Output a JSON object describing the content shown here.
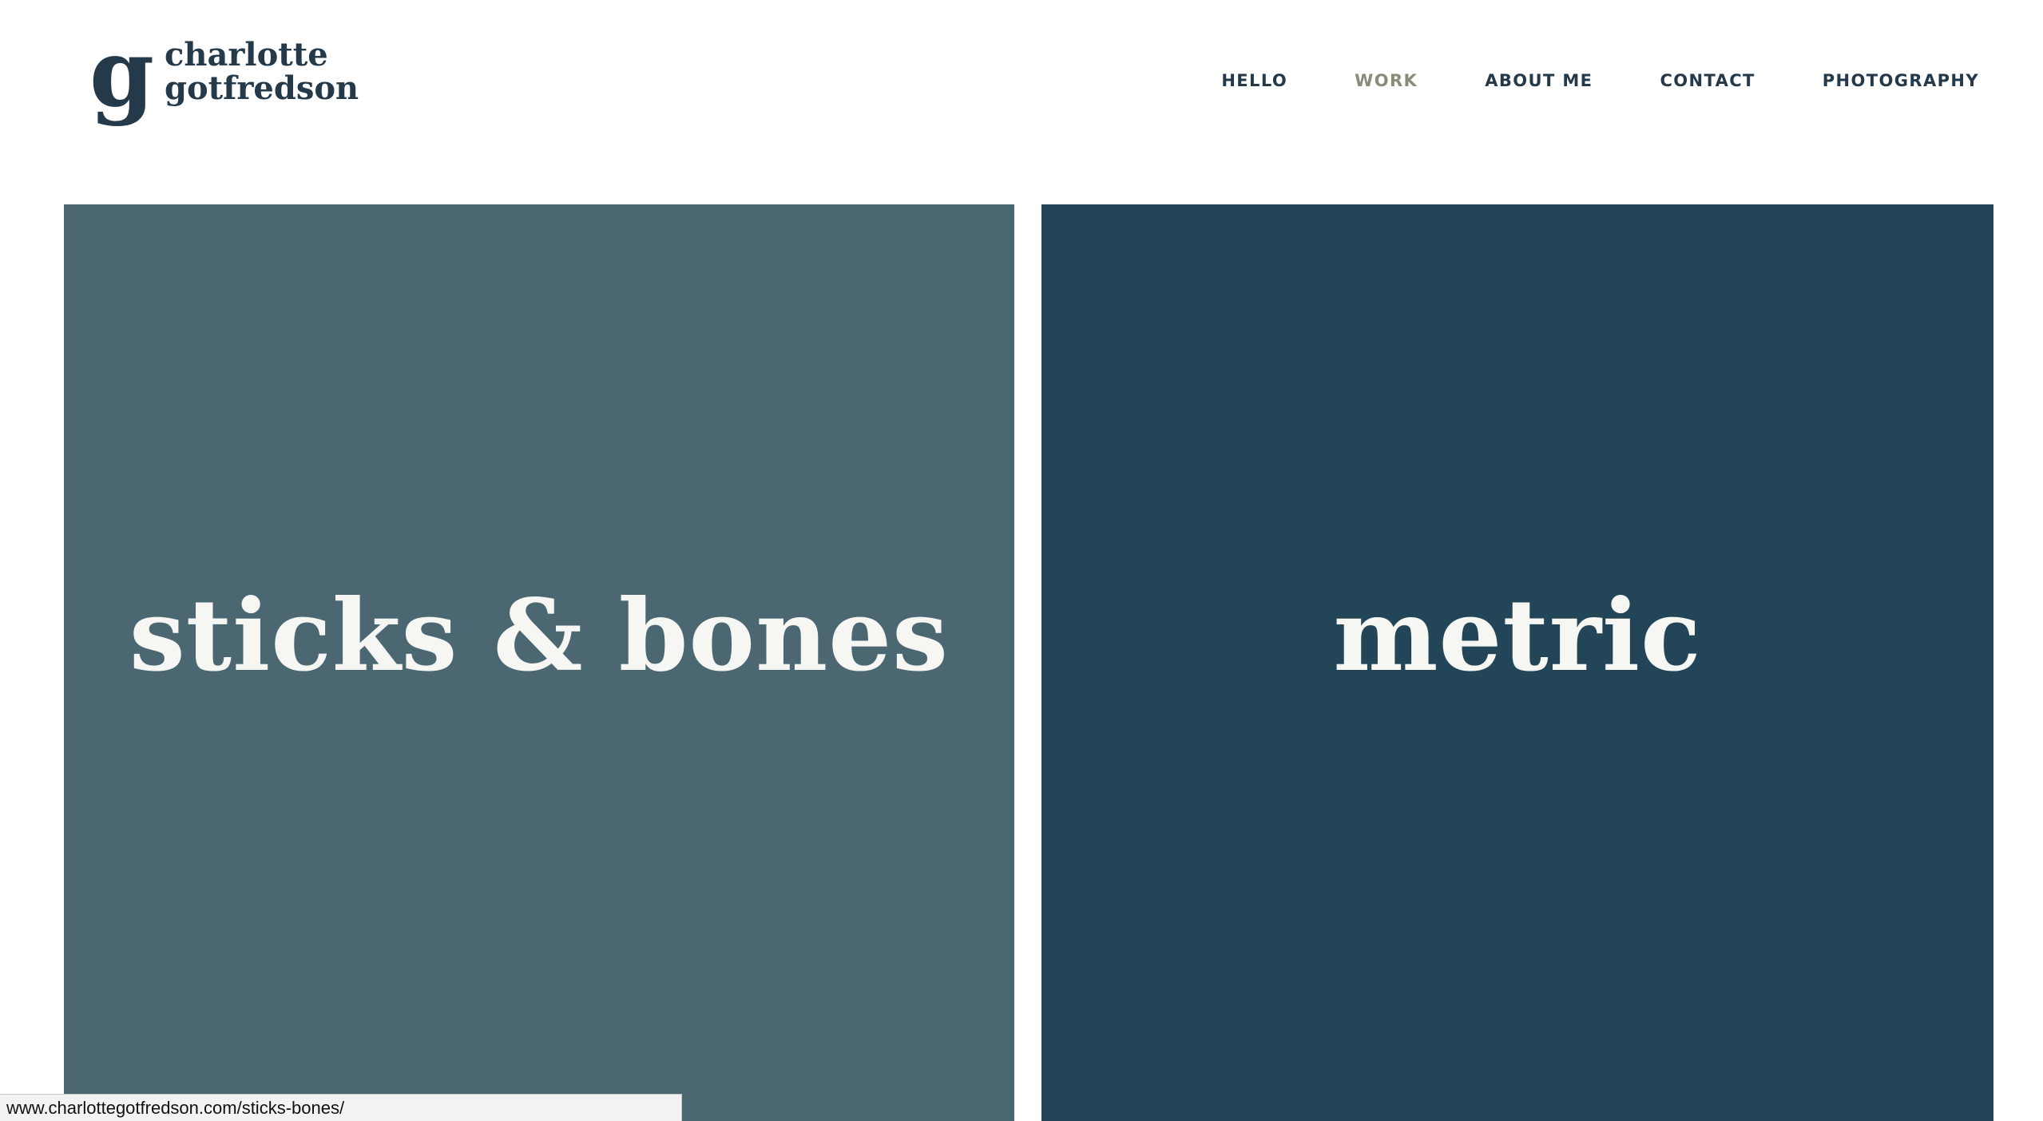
{
  "brand": {
    "mark": "g",
    "line1": "charlotte",
    "line2": "gotfredson"
  },
  "nav": {
    "items": [
      {
        "label": "HELLO"
      },
      {
        "label": "WORK",
        "active": true
      },
      {
        "label": "ABOUT ME"
      },
      {
        "label": "CONTACT"
      },
      {
        "label": "PHOTOGRAPHY"
      }
    ]
  },
  "portfolio": {
    "tiles": [
      {
        "title": "sticks & bones",
        "color": "#4b6772"
      },
      {
        "title": "metric",
        "color": "#224557"
      }
    ]
  },
  "status_bar": {
    "url": "www.charlottegotfredson.com/sticks-bones/"
  },
  "colors": {
    "primary": "#24394a",
    "active_nav": "#8b8b7a",
    "tile_text": "#f6f6f3"
  }
}
